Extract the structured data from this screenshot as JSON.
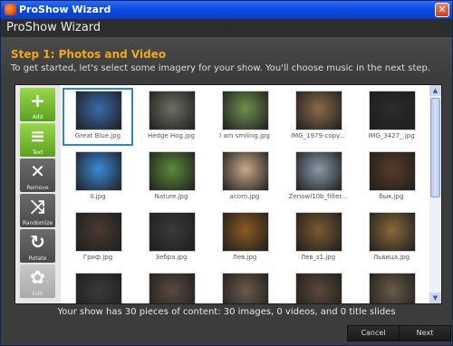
{
  "window": {
    "title": "ProShow Wizard",
    "header": "ProShow Wizard"
  },
  "step": {
    "title": "Step 1: Photos and Video",
    "description": "To get started, let's select some imagery for your show. You'll choose music in the next step."
  },
  "tools": [
    {
      "label": "Add",
      "icon": "plus-icon",
      "glyph": "+"
    },
    {
      "label": "Text",
      "icon": "text-icon",
      "glyph": "≡"
    },
    {
      "label": "Remove",
      "icon": "close-icon",
      "glyph": "✕"
    },
    {
      "label": "Randomize",
      "icon": "shuffle-icon",
      "glyph": "⤨"
    },
    {
      "label": "Rotate",
      "icon": "rotate-icon",
      "glyph": "↻"
    },
    {
      "label": "Edit",
      "icon": "gear-icon",
      "glyph": "✿"
    }
  ],
  "thumbnails": [
    {
      "caption": "Great Blue.jpg",
      "color": "#3a6aa8",
      "selected": true
    },
    {
      "caption": "Hedge Hog.jpg",
      "color": "#6e6e62"
    },
    {
      "caption": "I am smiling.jpg",
      "color": "#6f8f4e"
    },
    {
      "caption": "IMG_1979-copy...",
      "color": "#8a6a48"
    },
    {
      "caption": "IMG_3427_.jpg",
      "color": "#2b2b2b"
    },
    {
      "caption": "II.jpg",
      "color": "#3b8ad8"
    },
    {
      "caption": "Nature.jpg",
      "color": "#5c8a3a"
    },
    {
      "caption": "acorn.jpg",
      "color": "#c8a888"
    },
    {
      "caption": "Zenowl10b_filter...",
      "color": "#8a98a8"
    },
    {
      "caption": "бык.jpg",
      "color": "#5a3a28"
    },
    {
      "caption": "Гриф.jpg",
      "color": "#4a3a30"
    },
    {
      "caption": "Зебра.jpg",
      "color": "#3a3a3a"
    },
    {
      "caption": "Лев.jpg",
      "color": "#8a5a20"
    },
    {
      "caption": "Лев_s1.jpg",
      "color": "#7a5a30"
    },
    {
      "caption": "Львица.jpg",
      "color": "#8a6a3a"
    },
    {
      "caption": "",
      "color": "#3a3a3a"
    },
    {
      "caption": "",
      "color": "#5a4a40"
    },
    {
      "caption": "",
      "color": "#6a5a4a"
    },
    {
      "caption": "",
      "color": "#5a4838"
    },
    {
      "caption": "",
      "color": "#6a5a48"
    }
  ],
  "summary": "Your show has 30 pieces of content: 30 images, 0 videos, and 0 title slides",
  "buttons": {
    "cancel": "Cancel",
    "next": "Next"
  },
  "colors": {
    "accent": "#f0a820",
    "selection": "#2a86d8"
  }
}
